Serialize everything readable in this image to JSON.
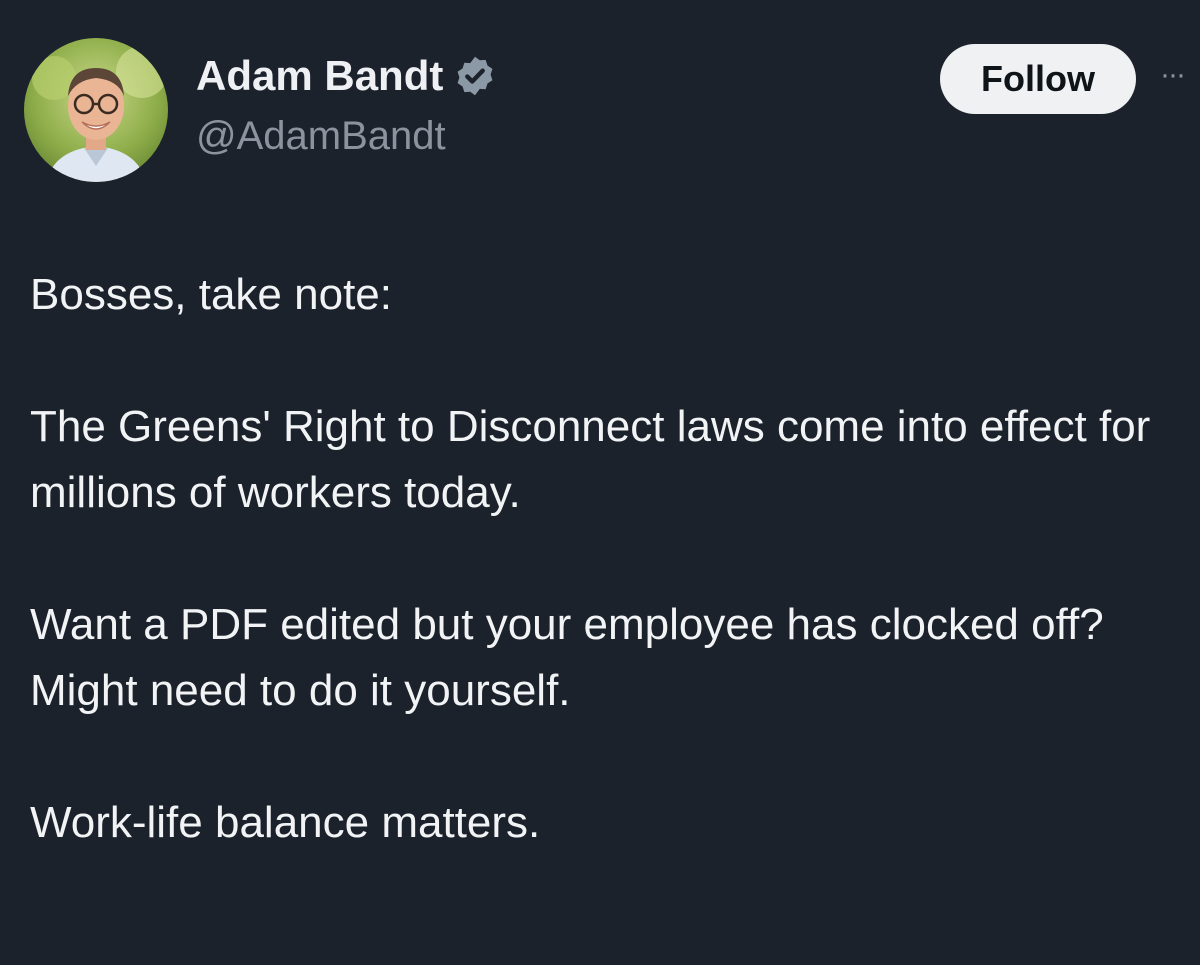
{
  "author": {
    "display_name": "Adam Bandt",
    "handle": "@AdamBandt",
    "verified": true,
    "verified_badge_color": "#8b98a5",
    "avatar_icon": "profile-photo"
  },
  "actions": {
    "follow_label": "Follow",
    "more_label": "···"
  },
  "tweet": {
    "paragraphs": [
      "Bosses, take note:",
      "The Greens' Right to Disconnect laws come into effect for millions of workers today.",
      "Want a PDF edited but your employee has clocked off? Might need to do it yourself.",
      "Work-life balance matters."
    ]
  },
  "colors": {
    "background": "#1c222c",
    "text": "#f1f3f5",
    "secondary_text": "#8b949e",
    "button_bg": "#eff1f3"
  }
}
